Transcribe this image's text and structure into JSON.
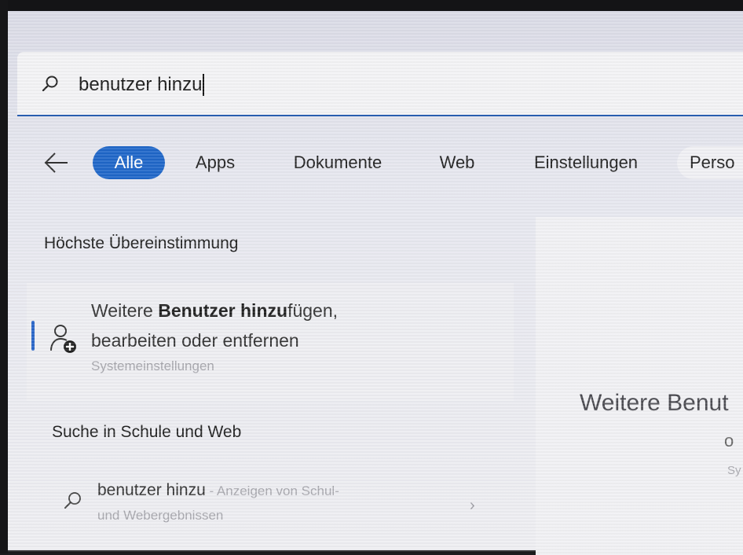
{
  "search": {
    "query": "benutzer hinzu",
    "icon": "search-icon"
  },
  "filters": {
    "back_icon": "arrow-left-icon",
    "tabs": [
      {
        "label": "Alle",
        "active": true
      },
      {
        "label": "Apps",
        "active": false
      },
      {
        "label": "Dokumente",
        "active": false
      },
      {
        "label": "Web",
        "active": false
      },
      {
        "label": "Einstellungen",
        "active": false
      },
      {
        "label": "Perso",
        "active": false
      }
    ]
  },
  "best_match": {
    "section_title": "Höchste Übereinstimmung",
    "line1_pre": "Weitere ",
    "line1_bold": "Benutzer hinzu",
    "line1_post": "fügen,",
    "line2": "bearbeiten oder entfernen",
    "category": "Systemeinstellungen",
    "icon": "user-add-icon"
  },
  "web_search": {
    "section_title": "Suche in Schule und Web",
    "query": "benutzer hinzu",
    "suffix": " - Anzeigen von Schul-",
    "line2": "und Webergebnissen",
    "icon": "search-icon",
    "chevron": "›"
  },
  "preview": {
    "title": "Weitere Benut",
    "sub": "o",
    "category": "Sy"
  },
  "colors": {
    "accent": "#1f66c8",
    "underline": "#2a5fb3"
  }
}
